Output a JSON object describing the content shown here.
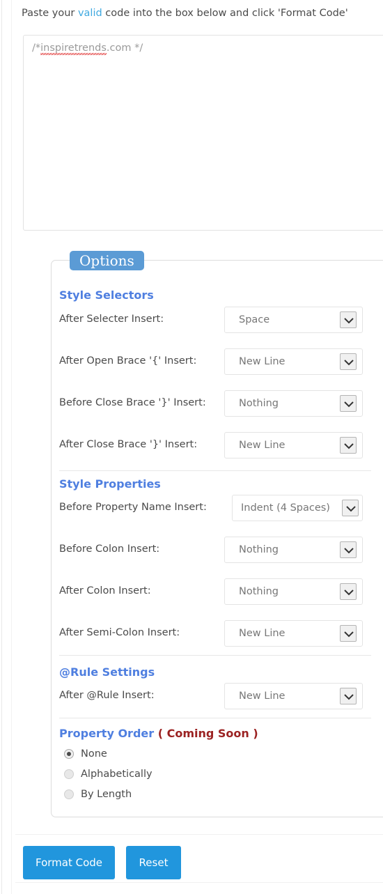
{
  "intro": {
    "before": "Paste your ",
    "link": "valid",
    "after": " code into the box below and click 'Format Code'"
  },
  "code_editor": {
    "placeholder_pre": "/*",
    "placeholder_misspelled": "inspiretrends",
    "placeholder_post": ".com */",
    "value": ""
  },
  "options_panel": {
    "legend": "Options",
    "sections": [
      {
        "heading": "Style Selectors",
        "rows": [
          {
            "label": "After Selecter Insert:",
            "value": "Space"
          },
          {
            "label": "After Open Brace '{' Insert:",
            "value": "New Line"
          },
          {
            "label": "Before Close Brace '}' Insert:",
            "value": "Nothing"
          },
          {
            "label": "After Close Brace '}' Insert:",
            "value": "New Line"
          }
        ]
      },
      {
        "heading": "Style Properties",
        "rows": [
          {
            "label": "Before Property Name Insert:",
            "value": "Indent (4 Spaces)"
          },
          {
            "label": "Before Colon Insert:",
            "value": "Nothing"
          },
          {
            "label": "After Colon Insert:",
            "value": "Nothing"
          },
          {
            "label": "After Semi-Colon Insert:",
            "value": "New Line"
          }
        ]
      },
      {
        "heading": "@Rule Settings",
        "rows": [
          {
            "label": "After @Rule Insert:",
            "value": "New Line"
          }
        ]
      }
    ],
    "property_order": {
      "heading": "Property Order",
      "heading_note": " ( Coming Soon )",
      "options": [
        {
          "label": "None",
          "selected": true
        },
        {
          "label": "Alphabetically",
          "selected": false
        },
        {
          "label": "By Length",
          "selected": false
        }
      ]
    }
  },
  "actions": {
    "format_label": "Format Code",
    "reset_label": "Reset"
  },
  "colors": {
    "accent_blue": "#2196dd",
    "legend_blue": "#5b9bd5",
    "heading_blue": "#4f7fe0",
    "link_blue": "#3fa9e0",
    "coming_soon_red": "#9b2222"
  },
  "icons": {
    "chevron_down": "chevron-down-icon"
  }
}
